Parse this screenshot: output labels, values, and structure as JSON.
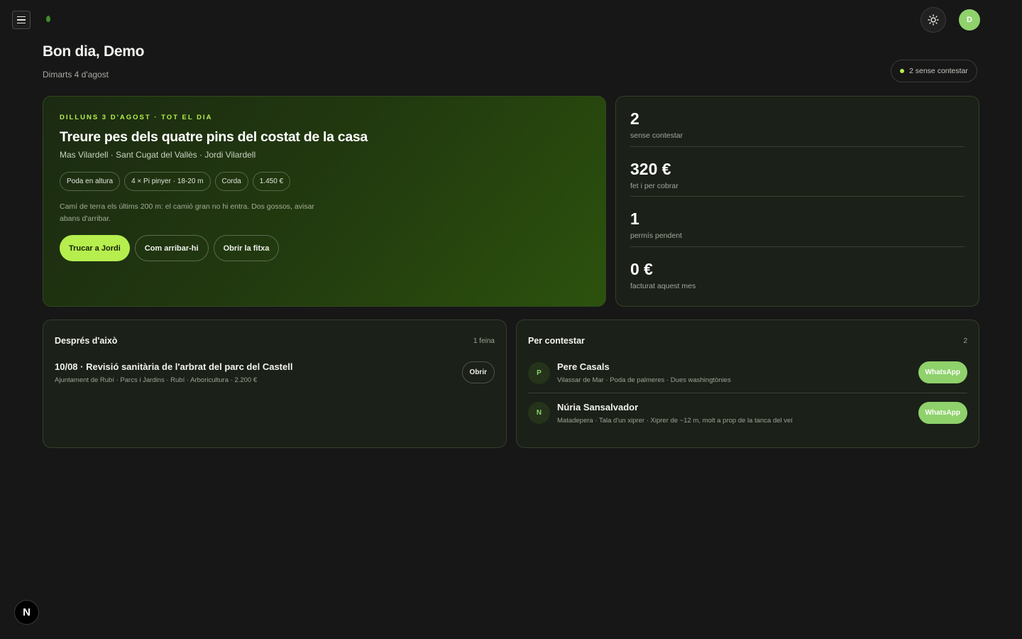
{
  "header": {
    "greeting": "Bon dia, Demo",
    "date": "Dimarts 4 d'agost",
    "avatar_initial": "D",
    "status_pill": "2 sense contestar"
  },
  "hero": {
    "kicker": "DILLUNS 3 D'AGOST · TOT EL DIA",
    "title": "Treure pes dels quatre pins del costat de la casa",
    "subtitle": "Mas Vilardell · Sant Cugat del Vallès · Jordi Vilardell",
    "chips": [
      "Poda en altura",
      "4 × Pi pinyer · 18-20 m",
      "Corda",
      "1.450 €"
    ],
    "note": "Camí de terra els últims 200 m: el camió gran no hi entra. Dos gossos, avisar abans d'arribar.",
    "actions": {
      "call": "Trucar a Jordi",
      "directions": "Com arribar-hi",
      "open_file": "Obrir la fitxa"
    }
  },
  "stats": [
    {
      "value": "2",
      "label": "sense contestar"
    },
    {
      "value": "320 €",
      "label": "fet i per cobrar"
    },
    {
      "value": "1",
      "label": "permís pendent"
    },
    {
      "value": "0 €",
      "label": "facturat aquest mes"
    }
  ],
  "next_jobs": {
    "title": "Després d'això",
    "count": "1 feina",
    "items": [
      {
        "title": "10/08 · Revisió sanitària de l'arbrat del parc del Castell",
        "meta": "Ajuntament de Rubí · Parcs i Jardins · Rubí · Arboricultura · 2.200 €",
        "action": "Obrir"
      }
    ]
  },
  "to_answer": {
    "title": "Per contestar",
    "count": "2",
    "items": [
      {
        "initial": "P",
        "name": "Pere Casals",
        "meta": "Vilassar de Mar · Poda de palmeres · Dues washingtònies",
        "action": "WhatsApp"
      },
      {
        "initial": "N",
        "name": "Núria Sansalvador",
        "meta": "Matadepera · Tala d'un xiprer · Xiprer de ~12 m, molt a prop de la tanca del veí",
        "action": "WhatsApp"
      }
    ]
  },
  "dev_badge": "N",
  "colors": {
    "accent": "#b6ee4e",
    "whatsapp_button": "#8fd16b",
    "background": "#171717"
  },
  "icons": {
    "menu": "menu-icon",
    "theme": "sun-icon",
    "brand": "leaf-icon"
  }
}
